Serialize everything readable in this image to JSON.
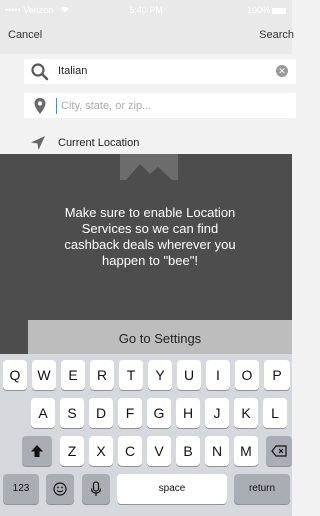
{
  "status_bar": {
    "carrier": "••••• Verizon",
    "time": "5:40 PM",
    "battery": "100%"
  },
  "nav": {
    "cancel_label": "Cancel",
    "search_label": "Search"
  },
  "search": {
    "query_value": "Italian",
    "location_placeholder": "City, state, or zip..."
  },
  "current_location": {
    "label": "Current Location"
  },
  "message": {
    "text": "Make sure to enable Location Services so we can find cashback deals wherever you happen to \"bee\"!"
  },
  "settings_button": {
    "label": "Go to Settings"
  },
  "keyboard": {
    "row1": [
      "Q",
      "W",
      "E",
      "R",
      "T",
      "Y",
      "U",
      "I",
      "O",
      "P"
    ],
    "row2": [
      "A",
      "S",
      "D",
      "F",
      "G",
      "H",
      "J",
      "K",
      "L"
    ],
    "row3": [
      "Z",
      "X",
      "C",
      "V",
      "B",
      "N",
      "M"
    ],
    "numbers_label": "123",
    "space_label": "space",
    "return_label": "return"
  },
  "icons": {
    "search": "search-icon",
    "pin": "location-pin-icon",
    "arrow": "location-arrow-icon",
    "map": "map-icon",
    "shift": "shift-icon",
    "delete": "delete-icon",
    "emoji": "emoji-icon",
    "mic": "microphone-icon"
  }
}
